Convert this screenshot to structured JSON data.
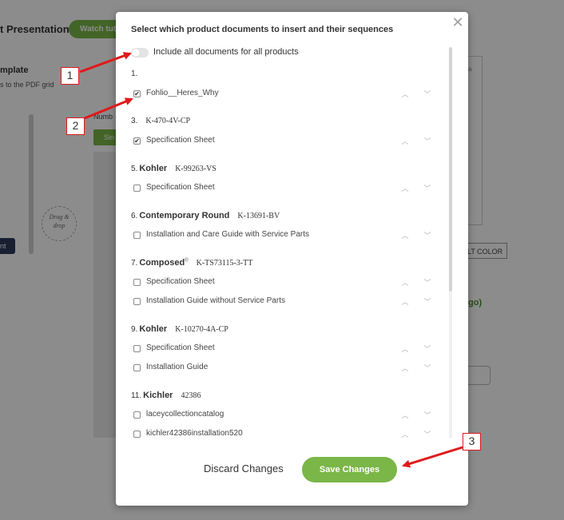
{
  "background": {
    "title": "t Presentation",
    "watch_label": "Watch tuto",
    "template_title": "mplate",
    "template_sub": "s to the PDF grid",
    "drag_hint": "Drag & drop",
    "side_button": "nt",
    "number_label": "Numb",
    "green_button": "Sin",
    "color_button": "LT COLOR",
    "go_link": "go)",
    "right_mark": "a"
  },
  "modal": {
    "heading": "Select which product documents to insert and their sequences",
    "close_glyph": "✕",
    "toggle_label": "Include all documents for all products",
    "toggle_on": false,
    "groups": [
      {
        "number": "1.",
        "brand": "",
        "sup": "",
        "sku": "",
        "docs": [
          {
            "label": "Fohlio__Heres_Why",
            "checked": true
          }
        ]
      },
      {
        "number": "3.",
        "brand": "",
        "sup": "",
        "sku": "K-470-4V-CP",
        "docs": [
          {
            "label": "Specification Sheet",
            "checked": true
          }
        ]
      },
      {
        "number": "5.",
        "brand": "Kohler",
        "sup": "",
        "sku": "K-99263-VS",
        "docs": [
          {
            "label": "Specification Sheet",
            "checked": false
          }
        ]
      },
      {
        "number": "6.",
        "brand": "Contemporary Round",
        "sup": "",
        "sku": "K-13691-BV",
        "docs": [
          {
            "label": "Installation and Care Guide with Service Parts",
            "checked": false
          }
        ]
      },
      {
        "number": "7.",
        "brand": "Composed",
        "sup": "®",
        "sku": "K-TS73115-3-TT",
        "docs": [
          {
            "label": "Specification Sheet",
            "checked": false
          },
          {
            "label": "Installation Guide without Service Parts",
            "checked": false
          }
        ]
      },
      {
        "number": "9.",
        "brand": "Kohler",
        "sup": "",
        "sku": "K-10270-4A-CP",
        "docs": [
          {
            "label": "Specification Sheet",
            "checked": false
          },
          {
            "label": "Installation Guide",
            "checked": false
          }
        ]
      },
      {
        "number": "11.",
        "brand": "Kichler",
        "sup": "",
        "sku": "42386",
        "docs": [
          {
            "label": "laceycollectioncatalog",
            "checked": false
          },
          {
            "label": "kichler42386installation520",
            "checked": false
          }
        ]
      }
    ],
    "arrow_up_glyph": "︿",
    "arrow_down_glyph": "﹀",
    "discard_label": "Discard Changes",
    "save_label": "Save Changes"
  },
  "annotations": {
    "color": "#e0191b",
    "labels": [
      "1",
      "2",
      "3"
    ]
  },
  "colors": {
    "accent": "#7ab648",
    "annotation": "#e0191b"
  }
}
